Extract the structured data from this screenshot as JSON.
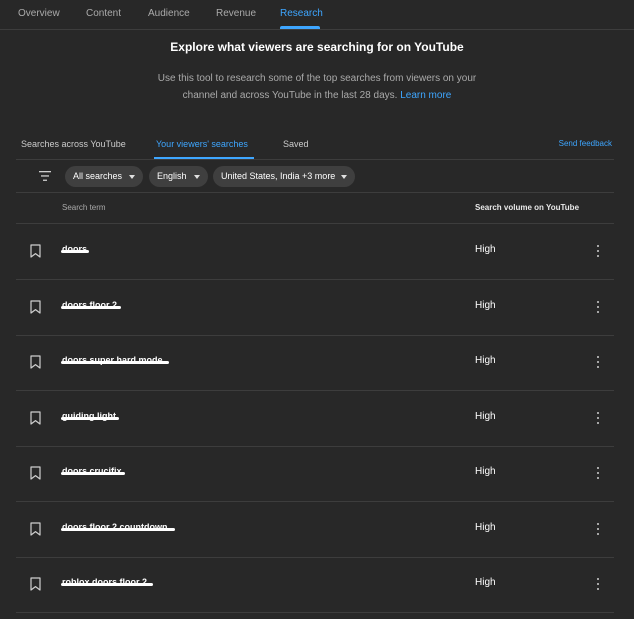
{
  "nav": {
    "tabs": [
      {
        "label": "Overview"
      },
      {
        "label": "Content"
      },
      {
        "label": "Audience"
      },
      {
        "label": "Revenue"
      },
      {
        "label": "Research",
        "active": true
      }
    ]
  },
  "header": {
    "title": "Explore what viewers are searching for on YouTube",
    "description_line1": "Use this tool to research some of the top searches from viewers on your",
    "description_line2": "channel and across YouTube in the last 28 days.",
    "learn_more": "Learn more"
  },
  "subtabs": {
    "items": [
      {
        "label": "Searches across YouTube"
      },
      {
        "label": "Your viewers' searches",
        "active": true
      },
      {
        "label": "Saved"
      }
    ],
    "feedback": "Send feedback"
  },
  "filters": {
    "icon": "filter-icon",
    "search_type": "All searches",
    "language": "English",
    "location": "United States, India +3 more"
  },
  "table": {
    "columns": [
      "Search term",
      "Search volume on YouTube"
    ],
    "rows": [
      {
        "term": "doors",
        "volume": "High"
      },
      {
        "term": "doors floor 2",
        "volume": "High"
      },
      {
        "term": "doors super hard mode",
        "volume": "High"
      },
      {
        "term": "guiding light",
        "volume": "High"
      },
      {
        "term": "doors crucifix",
        "volume": "High"
      },
      {
        "term": "doors floor 2 countdown",
        "volume": "High"
      },
      {
        "term": "roblox doors floor 2",
        "volume": "High"
      }
    ]
  },
  "colors": {
    "background": "#282828",
    "accent": "#3ea6ff",
    "chip": "#3f3f3f",
    "divider": "#3d3d3d"
  }
}
